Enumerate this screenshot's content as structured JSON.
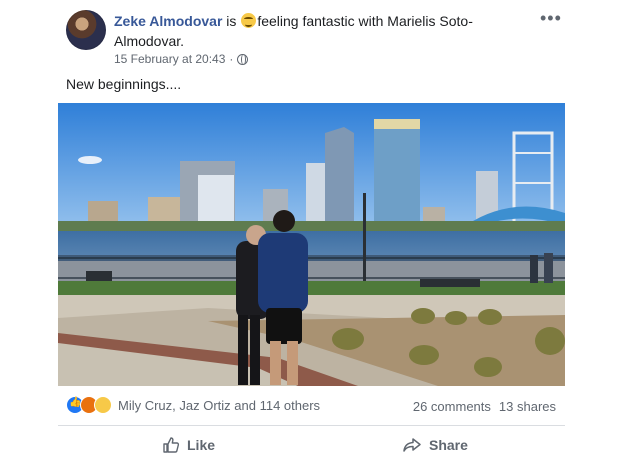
{
  "post": {
    "author": "Zeke Almodovar",
    "activity_prefix": "is",
    "feeling_text": "feeling fantastic with",
    "tagged_person": "Marielis Soto-Almodovar",
    "period": ".",
    "timestamp": "15 February at 20:43",
    "separator": "·",
    "privacy_icon": "globe-icon",
    "feeling_icon": "grinning-emoji-icon",
    "more_icon": "•••",
    "text": "New beginnings...."
  },
  "reactions": {
    "icons": [
      "like-reaction-icon",
      "angry-reaction-icon",
      "sad-reaction-icon"
    ],
    "names": "Mily Cruz, Jaz Ortiz and 114 others",
    "comments": "26 comments",
    "shares": "13 shares"
  },
  "actions": {
    "like_label": "Like",
    "share_label": "Share"
  },
  "colors": {
    "author_link": "#385898",
    "muted_text": "#606770",
    "like_blue": "#2078f4",
    "divider": "#dadde1"
  }
}
